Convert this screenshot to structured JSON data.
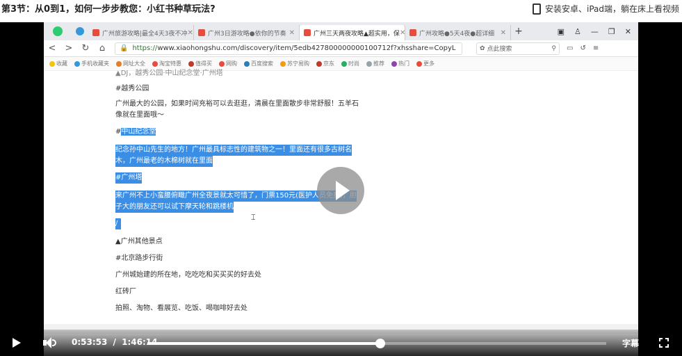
{
  "lesson": {
    "title": "第3节：从0到1，如何一步步教您：小红书种草玩法?",
    "install_text": "安装安卓、iPad端，躺在床上看视频"
  },
  "browser": {
    "tabs": [
      {
        "label": "广州旅游攻略|最全4天3夜不冲"
      },
      {
        "label": "广州3日游攻略●依你的节奏"
      },
      {
        "label": "广州三天两夜攻略▲超实用，保"
      },
      {
        "label": "广州攻略●5天4夜●超详细"
      }
    ],
    "url_secure": "https://",
    "url_rest": "www.xiaohongshu.com/discovery/item/5edb427800000000100712f?xhsshare=CopyL",
    "search_placeholder": "点此搜索",
    "bookmarks": [
      "收藏",
      "手机收藏夹",
      "网址大全",
      "淘宝特惠",
      "值得买",
      "网购",
      "百度搜索",
      "苏宁易购",
      "京东",
      "时尚",
      "推荐",
      "热门",
      "更多"
    ]
  },
  "page": {
    "line_top": "▲DJ，越秀公园·中山纪念堂·广州塔",
    "heading1": "#越秀公园",
    "para1a": "广州最大的公园，如果时间充裕可以去逛逛，清晨在里面散步非常舒服！五羊石",
    "para1b": "像就在里面哦～",
    "heading2_prefix": "#",
    "heading2": "中山纪念堂",
    "para2a": "纪念孙中山先生的地方！广州最具标志性的建筑物之一！里面还有很多古树名",
    "para2b": "木，广州最老的木棉树就在里面",
    "heading3": "#广州塔",
    "para3a": "来广州不上小蛮腰俯瞰广州全夜景就太可惜了，门票150元(医护人员免费)，胆",
    "para3b": "子大的朋友还可以试下摩天轮和跳楼机",
    "slash": "/",
    "section": "▲广州其他景点",
    "heading4": "#北京路步行街",
    "para4": "广州城始建的所在地，吃吃吃和买买买的好去处",
    "heading5": "红砖厂",
    "para5": "拍照、淘物、看展览、吃饭、喝咖啡好去处"
  },
  "player": {
    "current_time": "0:53:53",
    "separator": "/",
    "total_time": "1:46:14",
    "progress_fraction": 0.507,
    "subtitle_label": "字幕"
  },
  "colors": {
    "selection": "#3a8ee6",
    "secure_url": "#2a7a2a"
  }
}
